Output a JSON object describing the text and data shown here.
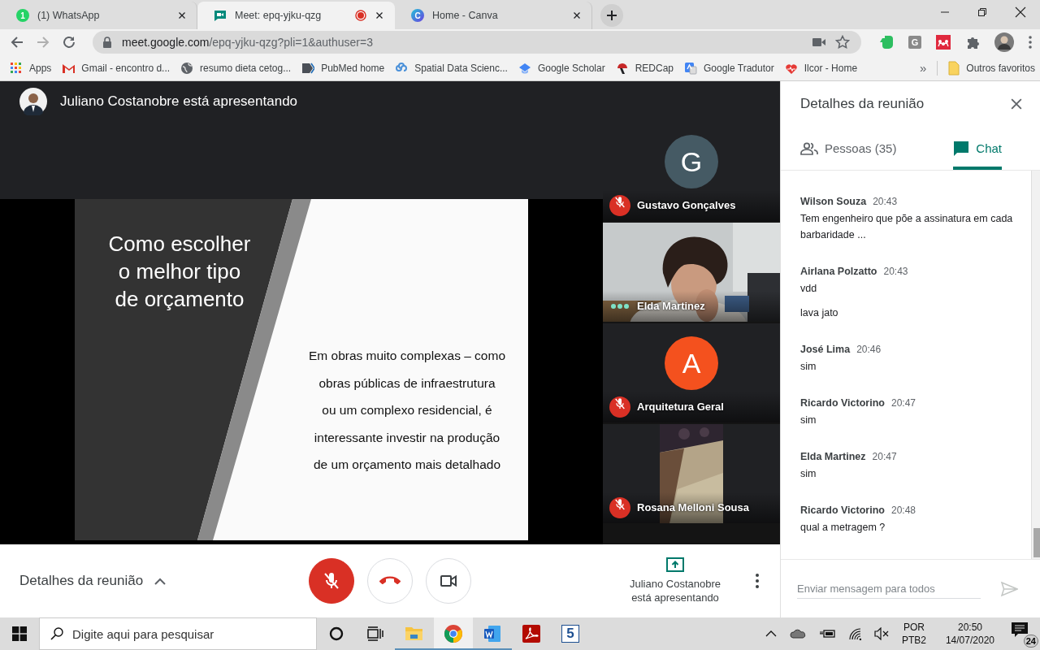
{
  "browser": {
    "tabs": [
      {
        "kind": "whatsapp",
        "badge": "1",
        "label": "(1) WhatsApp",
        "selected": false,
        "recording": false
      },
      {
        "kind": "meet",
        "label": "Meet: epq-yjku-qzg",
        "selected": true,
        "recording": true
      },
      {
        "kind": "canva",
        "badge": "C",
        "label": "Home - Canva",
        "selected": false,
        "recording": false
      }
    ],
    "address": {
      "host": "meet.google.com",
      "path": "/epq-yjku-qzg?pli=1&authuser=3"
    },
    "extensions": [
      {
        "kind": "evernote"
      },
      {
        "kind": "letter",
        "label": "G"
      },
      {
        "kind": "mendeley"
      },
      {
        "kind": "puzzle"
      },
      {
        "kind": "profile"
      }
    ],
    "bookmarks": [
      {
        "kind": "apps",
        "label": "Apps"
      },
      {
        "kind": "gmail",
        "label": "Gmail - encontro d..."
      },
      {
        "kind": "globe",
        "label": "resumo dieta cetog..."
      },
      {
        "kind": "pubmed",
        "label": "PubMed home"
      },
      {
        "kind": "link",
        "label": "Spatial Data Scienc..."
      },
      {
        "kind": "scholar",
        "label": "Google Scholar"
      },
      {
        "kind": "redcap",
        "label": "REDCap"
      },
      {
        "kind": "translate",
        "label": "Google Tradutor"
      },
      {
        "kind": "heart",
        "label": "Ilcor - Home"
      }
    ],
    "more_bookmarks": "»",
    "other_bookmarks": "Outros favoritos"
  },
  "meet": {
    "presenter_banner": "Juliano Costanobre está apresentando",
    "slide": {
      "title_lines": [
        "Como escolher",
        "o melhor tipo",
        "de orçamento"
      ],
      "body_lines": [
        "Em obras muito complexas – como",
        "obras públicas de infraestrutura",
        "ou um complexo residencial, é",
        "interessante investir na produção",
        "de um orçamento mais detalhado"
      ]
    },
    "participants": [
      {
        "kind": "avatar",
        "name": "Gustavo Gonçalves",
        "letter": "G",
        "color": "#455a64",
        "muted": true
      },
      {
        "kind": "video",
        "name": "Elda Martinez",
        "muted": false
      },
      {
        "kind": "avatar",
        "name": "Arquitetura Geral",
        "letter": "A",
        "color": "#f4511e",
        "muted": true
      },
      {
        "kind": "portrait-video",
        "name": "Rosana Melloni Sousa",
        "muted": true
      }
    ]
  },
  "panel": {
    "title": "Detalhes da reunião",
    "tabs": [
      {
        "kind": "people",
        "label": "Pessoas (35)",
        "selected": false
      },
      {
        "kind": "chat",
        "label": "Chat",
        "selected": true
      }
    ],
    "messages": [
      {
        "sender": "Wilson Souza",
        "time": "20:43",
        "lines": [
          "Tem engenheiro que põe a assinatura em cada barbaridade ..."
        ]
      },
      {
        "sender": "Airlana Polzatto",
        "time": "20:43",
        "lines": [
          "vdd",
          "lava jato"
        ]
      },
      {
        "sender": "José Lima",
        "time": "20:46",
        "lines": [
          "sim"
        ]
      },
      {
        "sender": "Ricardo Victorino",
        "time": "20:47",
        "lines": [
          "sim"
        ]
      },
      {
        "sender": "Elda Martinez",
        "time": "20:47",
        "lines": [
          "sim"
        ]
      },
      {
        "sender": "Ricardo Victorino",
        "time": "20:48",
        "lines": [
          "qual a metragem ?"
        ]
      }
    ],
    "placeholder": "Enviar mensagem para todos"
  },
  "bar": {
    "details_label": "Detalhes da reunião",
    "mic_muted": true,
    "presenting": "Juliano Costanobre está apresentando"
  },
  "taskbar": {
    "placeholder": "Digite aqui para pesquisar",
    "apps": [
      {
        "kind": "explorer",
        "open": true,
        "selected": false
      },
      {
        "kind": "chrome",
        "open": true,
        "selected": true
      },
      {
        "kind": "word",
        "open": true,
        "selected": false
      },
      {
        "kind": "acrobat",
        "open": false,
        "selected": false
      },
      {
        "kind": "five",
        "label": "5",
        "open": false,
        "selected": false
      }
    ],
    "input_language": "POR",
    "keyboard_layout": "PTB2",
    "time": "20:50",
    "date": "14/07/2020",
    "notifications": "24"
  }
}
